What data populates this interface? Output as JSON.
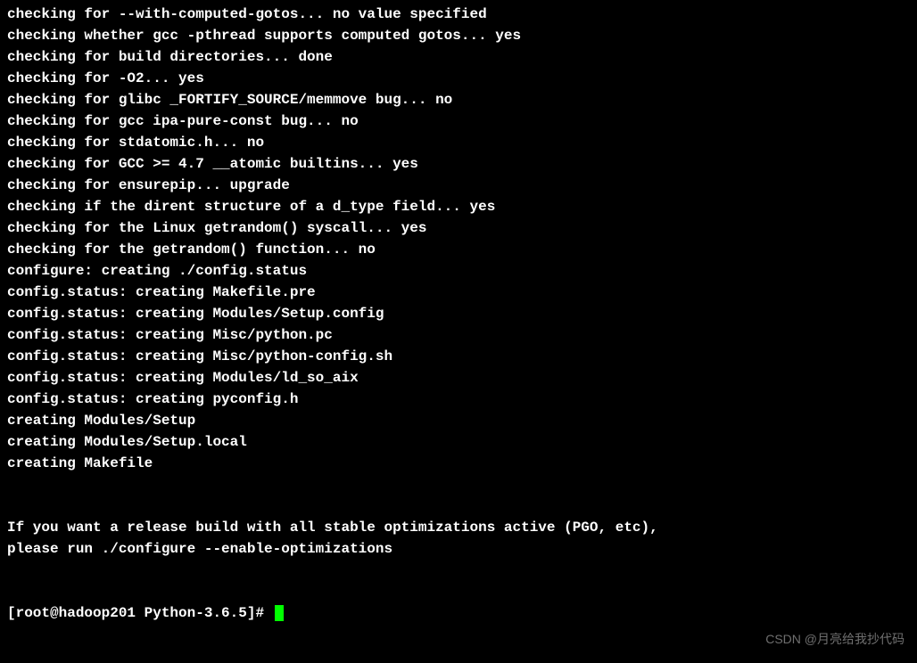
{
  "output": {
    "lines": [
      "checking for --with-computed-gotos... no value specified",
      "checking whether gcc -pthread supports computed gotos... yes",
      "checking for build directories... done",
      "checking for -O2... yes",
      "checking for glibc _FORTIFY_SOURCE/memmove bug... no",
      "checking for gcc ipa-pure-const bug... no",
      "checking for stdatomic.h... no",
      "checking for GCC >= 4.7 __atomic builtins... yes",
      "checking for ensurepip... upgrade",
      "checking if the dirent structure of a d_type field... yes",
      "checking for the Linux getrandom() syscall... yes",
      "checking for the getrandom() function... no",
      "configure: creating ./config.status",
      "config.status: creating Makefile.pre",
      "config.status: creating Modules/Setup.config",
      "config.status: creating Misc/python.pc",
      "config.status: creating Misc/python-config.sh",
      "config.status: creating Modules/ld_so_aix",
      "config.status: creating pyconfig.h",
      "creating Modules/Setup",
      "creating Modules/Setup.local",
      "creating Makefile",
      "",
      "",
      "If you want a release build with all stable optimizations active (PGO, etc),",
      "please run ./configure --enable-optimizations",
      "",
      ""
    ]
  },
  "prompt": {
    "text": "[root@hadoop201 Python-3.6.5]# "
  },
  "watermark": {
    "text": "CSDN @月亮给我抄代码"
  }
}
